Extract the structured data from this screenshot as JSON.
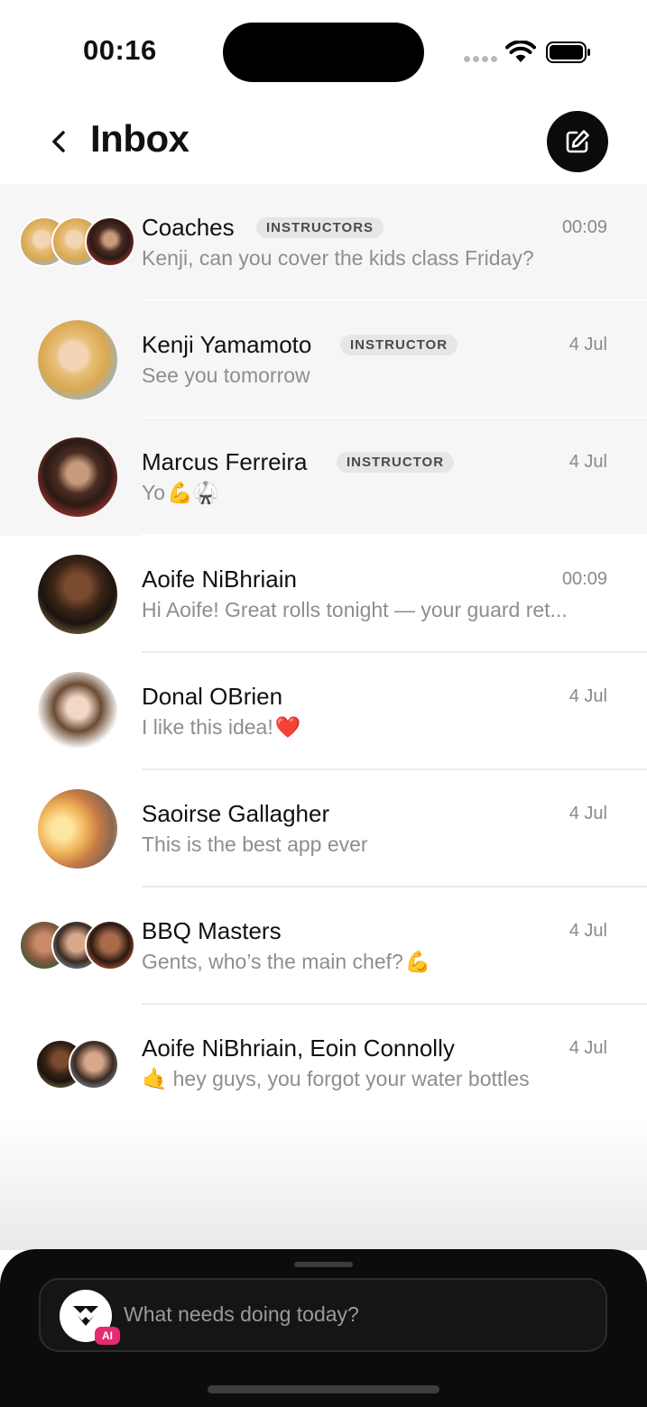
{
  "status_bar": {
    "time": "00:16"
  },
  "header": {
    "title": "Inbox"
  },
  "conversations": [
    {
      "name": "Coaches",
      "badge": "INSTRUCTORS",
      "time": "00:09",
      "preview": "Kenji, can you cover the kids class Friday?",
      "emoji": "",
      "unread": true
    },
    {
      "name": "Kenji Yamamoto",
      "badge": "INSTRUCTOR",
      "time": "4 Jul",
      "preview": "See you tomorrow",
      "emoji": "",
      "unread": true
    },
    {
      "name": "Marcus Ferreira",
      "badge": "INSTRUCTOR",
      "time": "4 Jul",
      "preview": "Yo",
      "emoji": "💪🥋",
      "unread": true
    },
    {
      "name": "Aoife NiBhriain",
      "badge": "",
      "time": "00:09",
      "preview": "Hi Aoife! Great rolls tonight — your guard ret...",
      "emoji": "",
      "unread": false
    },
    {
      "name": "Donal OBrien",
      "badge": "",
      "time": "4 Jul",
      "preview": "I like this idea!",
      "emoji": "❤️",
      "unread": false
    },
    {
      "name": "Saoirse Gallagher",
      "badge": "",
      "time": "4 Jul",
      "preview": "This is the best app ever",
      "emoji": "",
      "unread": false
    },
    {
      "name": "BBQ Masters",
      "badge": "",
      "time": "4 Jul",
      "preview": "Gents, who’s the main chef?",
      "emoji": "💪",
      "unread": false
    },
    {
      "name": "Aoife NiBhriain, Eoin Connolly",
      "badge": "",
      "time": "4 Jul",
      "preview": "hey guys, you forgot your water bottles",
      "emoji": "🤙",
      "unread": false
    }
  ],
  "assistant": {
    "placeholder": "What needs doing today?",
    "badge": "AI"
  },
  "icons": {
    "back": "chevron-left-icon",
    "compose": "compose-icon",
    "wifi": "wifi-icon",
    "battery": "battery-icon",
    "signal": "signal-icon",
    "assistant_logo": "assistant-logo-icon"
  },
  "colors": {
    "ai_badge": "#e52a6f",
    "sheet": "#0c0c0d",
    "unread_row": "#f6f6f6"
  }
}
